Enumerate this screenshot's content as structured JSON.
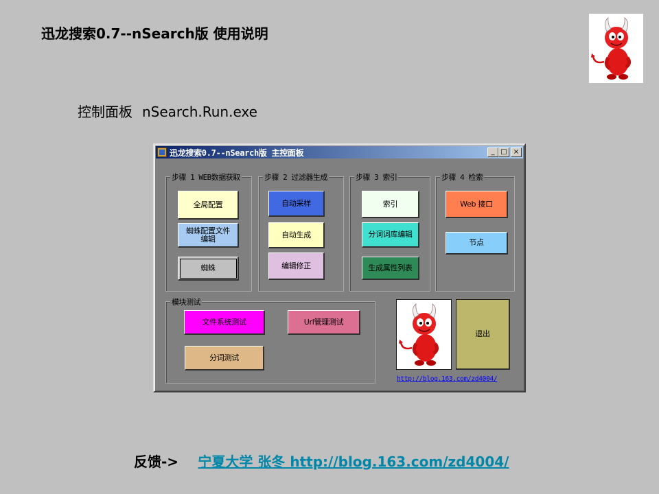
{
  "slide": {
    "title": "迅龙搜索0.7--nSearch版  使用说明",
    "subtitle_label": "控制面板",
    "subtitle_exe": "nSearch.Run.exe",
    "feedback_label": "反馈->",
    "feedback_link": "宁夏大学 张冬  http://blog.163.com/zd4004/"
  },
  "window": {
    "title": "迅龙搜索0.7--nSearch版  主控面板",
    "controls": {
      "minimize": "_",
      "maximize": "□",
      "close": "×"
    },
    "groups": {
      "step1": {
        "label": "步骤 1 WEB数据获取",
        "buttons": [
          "全局配置",
          "蜘蛛配置文件\n编辑",
          "蜘蛛"
        ],
        "colors": [
          "#ffffcc",
          "#a6caf0",
          "#c0c0c0"
        ]
      },
      "step2": {
        "label": "步骤 2 过滤器生成",
        "buttons": [
          "自动采样",
          "自动生成",
          "编辑修正"
        ],
        "colors": [
          "#4169e1",
          "#ffffc0",
          "#e0c0e0"
        ]
      },
      "step3": {
        "label": "步骤 3 索引",
        "buttons": [
          "索引",
          "分词词库编辑",
          "生成属性列表"
        ],
        "colors": [
          "#f0fff0",
          "#40e0d0",
          "#2e8b57"
        ]
      },
      "step4": {
        "label": "步骤 4 检索",
        "buttons": [
          "Web 接口",
          "节点"
        ],
        "colors": [
          "#ff7f50",
          "#87cefa"
        ]
      },
      "module_test": {
        "label": "模块测试",
        "buttons": [
          "文件系统测试",
          "Url管理测试",
          "分词测试"
        ],
        "colors": [
          "#ff00ff",
          "#db7093",
          "#deb887"
        ]
      }
    },
    "exit_button": {
      "label": "退出",
      "color": "#bdb76b"
    },
    "url": "http://blog.163.com/zd4004/"
  },
  "icons": {
    "logo": "freebsd-devil-mascot",
    "app_icon": "application-icon"
  }
}
